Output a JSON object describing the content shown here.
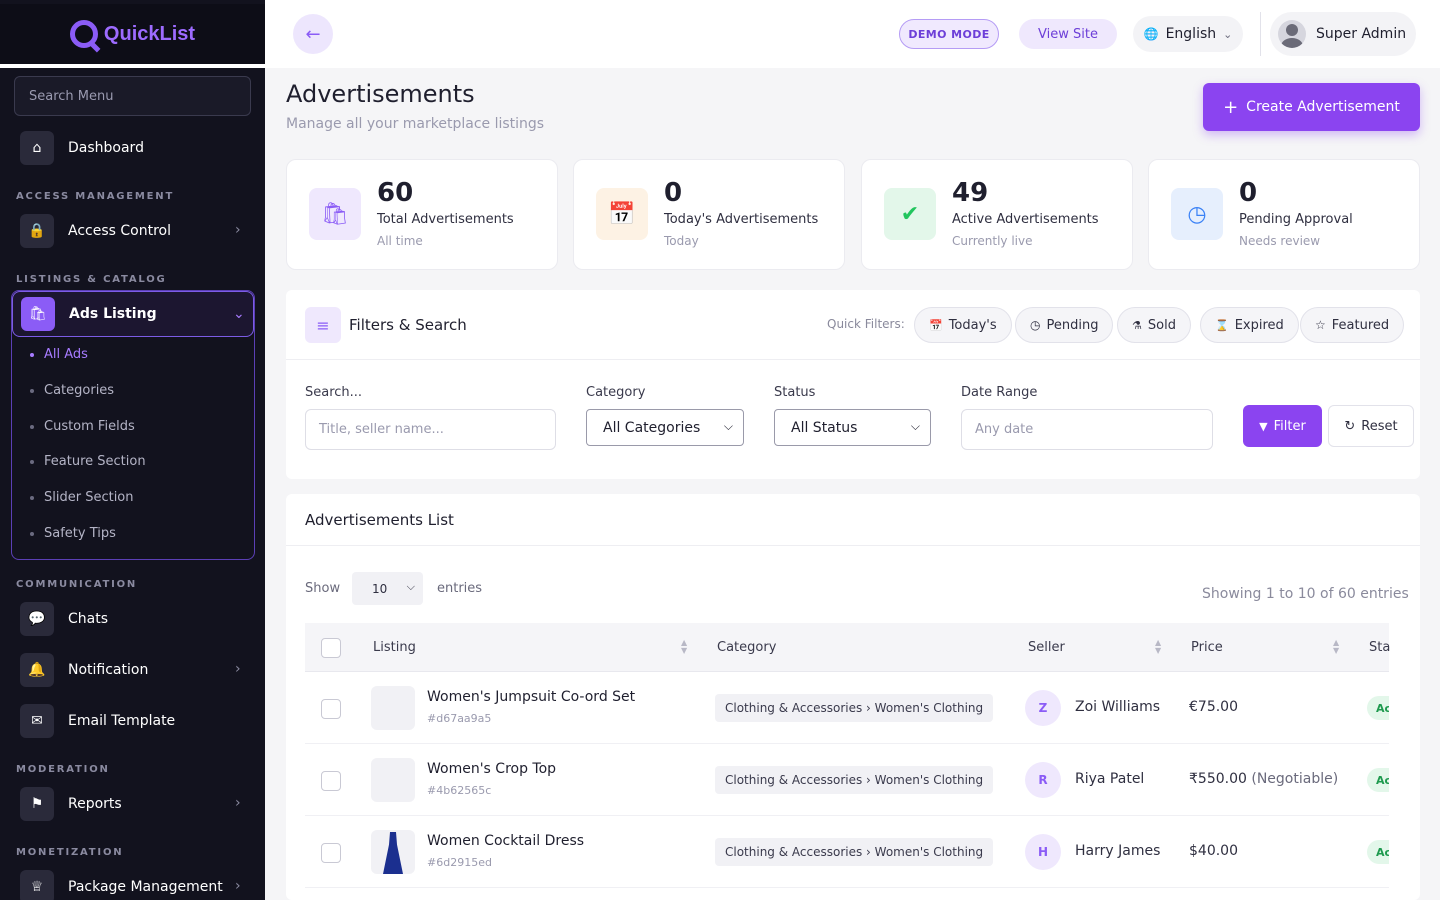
{
  "app": {
    "name": "QuickList"
  },
  "sidebar": {
    "search_placeholder": "Search Menu",
    "dashboard": "Dashboard",
    "sections": {
      "access": "ACCESS MANAGEMENT",
      "listings": "LISTINGS & CATALOG",
      "communication": "COMMUNICATION",
      "moderation": "MODERATION",
      "monetization": "MONETIZATION"
    },
    "access_control": "Access Control",
    "ads_listing": "Ads Listing",
    "ads_sub": [
      "All Ads",
      "Categories",
      "Custom Fields",
      "Feature Section",
      "Slider Section",
      "Safety Tips"
    ],
    "chats": "Chats",
    "notification": "Notification",
    "email_template": "Email Template",
    "reports": "Reports",
    "package_management": "Package Management"
  },
  "header": {
    "demo": "DEMO MODE",
    "view_site": "View Site",
    "language": "English",
    "user": "Super Admin"
  },
  "page": {
    "title": "Advertisements",
    "subtitle": "Manage all your marketplace listings",
    "create_button": "Create Advertisement"
  },
  "stats": [
    {
      "value": "60",
      "label": "Total Advertisements",
      "sub": "All time",
      "color": "#8b5cf6"
    },
    {
      "value": "0",
      "label": "Today's Advertisements",
      "sub": "Today",
      "color": "#f59e0b"
    },
    {
      "value": "49",
      "label": "Active Advertisements",
      "sub": "Currently live",
      "color": "#22c55e"
    },
    {
      "value": "0",
      "label": "Pending Approval",
      "sub": "Needs review",
      "color": "#3b82f6"
    }
  ],
  "filters": {
    "title": "Filters & Search",
    "quick_label": "Quick Filters:",
    "chips": [
      "Today's",
      "Pending",
      "Sold",
      "Expired",
      "Featured"
    ],
    "search_label": "Search...",
    "search_placeholder": "Title, seller name...",
    "category_label": "Category",
    "category_value": "All Categories",
    "status_label": "Status",
    "status_value": "All Status",
    "date_label": "Date Range",
    "date_placeholder": "Any date",
    "filter_button": "Filter",
    "reset_button": "Reset"
  },
  "list": {
    "title": "Advertisements List",
    "show": "Show",
    "entries_value": "10",
    "entries": "entries",
    "showing": "Showing 1 to 10 of 60 entries",
    "columns": [
      "Listing",
      "Category",
      "Seller",
      "Price",
      "Sta"
    ],
    "rows": [
      {
        "title": "Women's Jumpsuit Co-ord Set",
        "id": "#d67aa9a5",
        "category": "Clothing & Accessories › Women's Clothing",
        "initial": "Z",
        "seller": "Zoi Williams",
        "price": "€75.00",
        "negotiable": "",
        "status": "Ac"
      },
      {
        "title": "Women's Crop Top",
        "id": "#4b62565c",
        "category": "Clothing & Accessories › Women's Clothing",
        "initial": "R",
        "seller": "Riya Patel",
        "price": "₹550.00",
        "negotiable": "(Negotiable)",
        "status": "Ac"
      },
      {
        "title": "Women Cocktail Dress",
        "id": "#6d2915ed",
        "category": "Clothing & Accessories › Women's Clothing",
        "initial": "H",
        "seller": "Harry James",
        "price": "$40.00",
        "negotiable": "",
        "status": "Ac"
      }
    ]
  }
}
